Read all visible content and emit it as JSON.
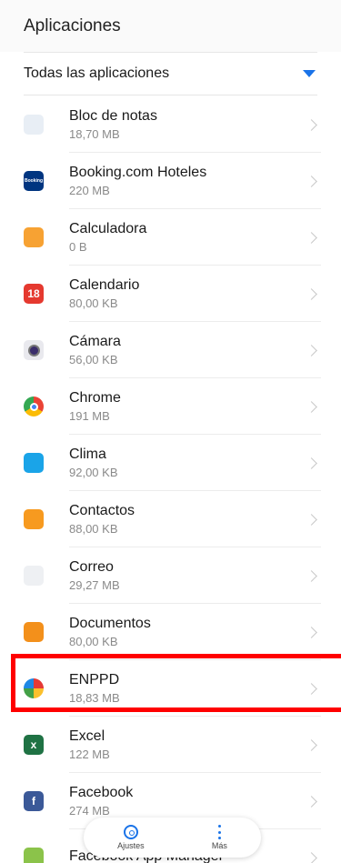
{
  "header": {
    "title": "Aplicaciones"
  },
  "filter": {
    "label": "Todas las aplicaciones",
    "accent": "#1a73e8"
  },
  "apps": [
    {
      "name": "Bloc de notas",
      "size": "18,70 MB",
      "icon": "notepad-icon",
      "color": "#e8eef5"
    },
    {
      "name": "Booking.com Hoteles",
      "size": "220 MB",
      "icon": "booking-icon",
      "color": "#003580",
      "glyph": "Booking"
    },
    {
      "name": "Calculadora",
      "size": "0 B",
      "icon": "calculator-icon",
      "color": "#f7a233"
    },
    {
      "name": "Calendario",
      "size": "80,00 KB",
      "icon": "calendar-icon",
      "color": "#e5392f",
      "glyph": "18"
    },
    {
      "name": "Cámara",
      "size": "56,00 KB",
      "icon": "camera-icon",
      "color": "#e9e9ee"
    },
    {
      "name": "Chrome",
      "size": "191 MB",
      "icon": "chrome-icon",
      "color": "#4285f4"
    },
    {
      "name": "Clima",
      "size": "92,00 KB",
      "icon": "weather-icon",
      "color": "#1aa4e8"
    },
    {
      "name": "Contactos",
      "size": "88,00 KB",
      "icon": "contacts-icon",
      "color": "#f79a1f"
    },
    {
      "name": "Correo",
      "size": "29,27 MB",
      "icon": "mail-icon",
      "color": "#eef0f3"
    },
    {
      "name": "Documentos",
      "size": "80,00 KB",
      "icon": "documents-icon",
      "color": "#f3901b"
    },
    {
      "name": "ENPPD",
      "size": "18,83 MB",
      "icon": "enppd-icon",
      "color": "#ffffff"
    },
    {
      "name": "Excel",
      "size": "122 MB",
      "icon": "excel-icon",
      "color": "#1f7244",
      "glyph": "x"
    },
    {
      "name": "Facebook",
      "size": "274 MB",
      "icon": "facebook-icon",
      "color": "#3b5998",
      "glyph": "f"
    },
    {
      "name": "Facebook App Manager",
      "size": "",
      "icon": "android-icon",
      "color": "#8bc34a"
    }
  ],
  "bottom_nav": {
    "settings_label": "Ajustes",
    "more_label": "Más"
  }
}
